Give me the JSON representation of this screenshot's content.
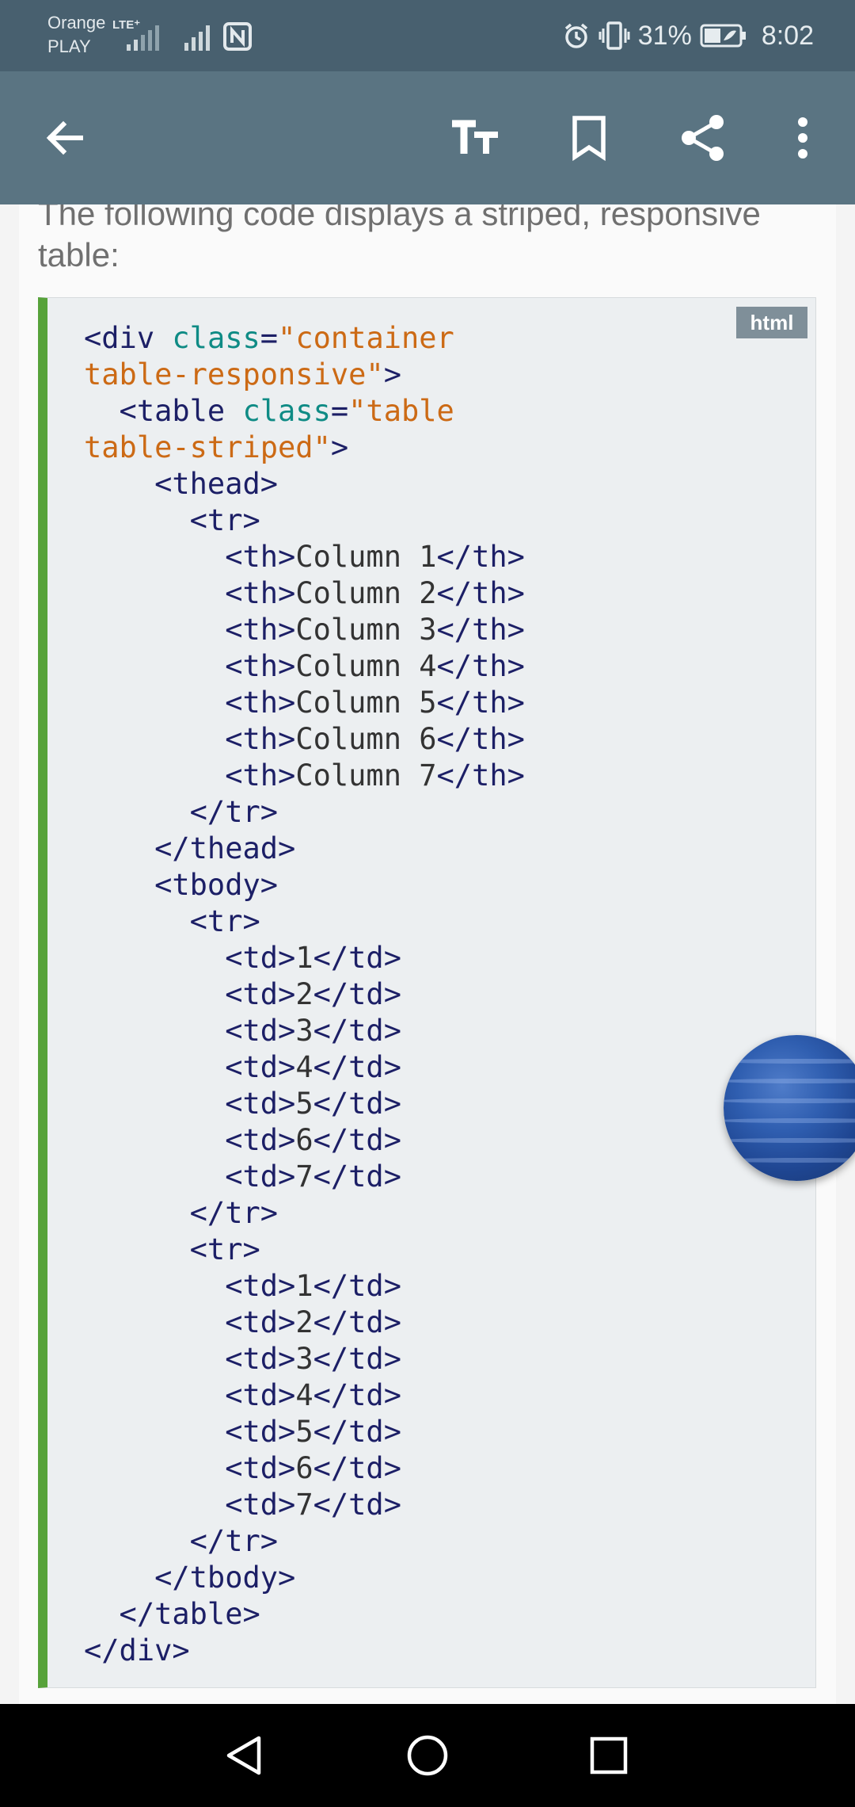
{
  "status_bar": {
    "carrier_line1": "Orange",
    "carrier_line2": "PLAY",
    "network": "LTE⁺",
    "battery_percent": "31%",
    "time": "8:02"
  },
  "app_bar": {
    "back_icon": "arrow-left-icon",
    "text_size_icon": "text-size-icon",
    "bookmark_icon": "bookmark-icon",
    "share_icon": "share-icon",
    "more_icon": "more-vert-icon"
  },
  "article": {
    "intro_text": "The following code displays a striped, responsive table:"
  },
  "code_block": {
    "language": "html",
    "lines": [
      [
        {
          "t": "tag",
          "v": "<div "
        },
        {
          "t": "attr",
          "v": "class"
        },
        {
          "t": "eq",
          "v": "="
        },
        {
          "t": "str",
          "v": "\"container"
        }
      ],
      [
        {
          "t": "str",
          "v": "table-responsive\""
        },
        {
          "t": "tag",
          "v": ">"
        }
      ],
      [
        {
          "t": "tag",
          "v": "  <table "
        },
        {
          "t": "attr",
          "v": "class"
        },
        {
          "t": "eq",
          "v": "="
        },
        {
          "t": "str",
          "v": "\"table"
        }
      ],
      [
        {
          "t": "str",
          "v": "table-striped\""
        },
        {
          "t": "tag",
          "v": ">"
        }
      ],
      [
        {
          "t": "tag",
          "v": "    <thead>"
        }
      ],
      [
        {
          "t": "tag",
          "v": "      <tr>"
        }
      ],
      [
        {
          "t": "tag",
          "v": "        <th>"
        },
        {
          "t": "text",
          "v": "Column 1"
        },
        {
          "t": "tag",
          "v": "</th>"
        }
      ],
      [
        {
          "t": "tag",
          "v": "        <th>"
        },
        {
          "t": "text",
          "v": "Column 2"
        },
        {
          "t": "tag",
          "v": "</th>"
        }
      ],
      [
        {
          "t": "tag",
          "v": "        <th>"
        },
        {
          "t": "text",
          "v": "Column 3"
        },
        {
          "t": "tag",
          "v": "</th>"
        }
      ],
      [
        {
          "t": "tag",
          "v": "        <th>"
        },
        {
          "t": "text",
          "v": "Column 4"
        },
        {
          "t": "tag",
          "v": "</th>"
        }
      ],
      [
        {
          "t": "tag",
          "v": "        <th>"
        },
        {
          "t": "text",
          "v": "Column 5"
        },
        {
          "t": "tag",
          "v": "</th>"
        }
      ],
      [
        {
          "t": "tag",
          "v": "        <th>"
        },
        {
          "t": "text",
          "v": "Column 6"
        },
        {
          "t": "tag",
          "v": "</th>"
        }
      ],
      [
        {
          "t": "tag",
          "v": "        <th>"
        },
        {
          "t": "text",
          "v": "Column 7"
        },
        {
          "t": "tag",
          "v": "</th>"
        }
      ],
      [
        {
          "t": "tag",
          "v": "      </tr>"
        }
      ],
      [
        {
          "t": "tag",
          "v": "    </thead>"
        }
      ],
      [
        {
          "t": "tag",
          "v": "    <tbody>"
        }
      ],
      [
        {
          "t": "tag",
          "v": "      <tr>"
        }
      ],
      [
        {
          "t": "tag",
          "v": "        <td>"
        },
        {
          "t": "text",
          "v": "1"
        },
        {
          "t": "tag",
          "v": "</td>"
        }
      ],
      [
        {
          "t": "tag",
          "v": "        <td>"
        },
        {
          "t": "text",
          "v": "2"
        },
        {
          "t": "tag",
          "v": "</td>"
        }
      ],
      [
        {
          "t": "tag",
          "v": "        <td>"
        },
        {
          "t": "text",
          "v": "3"
        },
        {
          "t": "tag",
          "v": "</td>"
        }
      ],
      [
        {
          "t": "tag",
          "v": "        <td>"
        },
        {
          "t": "text",
          "v": "4"
        },
        {
          "t": "tag",
          "v": "</td>"
        }
      ],
      [
        {
          "t": "tag",
          "v": "        <td>"
        },
        {
          "t": "text",
          "v": "5"
        },
        {
          "t": "tag",
          "v": "</td>"
        }
      ],
      [
        {
          "t": "tag",
          "v": "        <td>"
        },
        {
          "t": "text",
          "v": "6"
        },
        {
          "t": "tag",
          "v": "</td>"
        }
      ],
      [
        {
          "t": "tag",
          "v": "        <td>"
        },
        {
          "t": "text",
          "v": "7"
        },
        {
          "t": "tag",
          "v": "</td>"
        }
      ],
      [
        {
          "t": "tag",
          "v": "      </tr>"
        }
      ],
      [
        {
          "t": "tag",
          "v": "      <tr>"
        }
      ],
      [
        {
          "t": "tag",
          "v": "        <td>"
        },
        {
          "t": "text",
          "v": "1"
        },
        {
          "t": "tag",
          "v": "</td>"
        }
      ],
      [
        {
          "t": "tag",
          "v": "        <td>"
        },
        {
          "t": "text",
          "v": "2"
        },
        {
          "t": "tag",
          "v": "</td>"
        }
      ],
      [
        {
          "t": "tag",
          "v": "        <td>"
        },
        {
          "t": "text",
          "v": "3"
        },
        {
          "t": "tag",
          "v": "</td>"
        }
      ],
      [
        {
          "t": "tag",
          "v": "        <td>"
        },
        {
          "t": "text",
          "v": "4"
        },
        {
          "t": "tag",
          "v": "</td>"
        }
      ],
      [
        {
          "t": "tag",
          "v": "        <td>"
        },
        {
          "t": "text",
          "v": "5"
        },
        {
          "t": "tag",
          "v": "</td>"
        }
      ],
      [
        {
          "t": "tag",
          "v": "        <td>"
        },
        {
          "t": "text",
          "v": "6"
        },
        {
          "t": "tag",
          "v": "</td>"
        }
      ],
      [
        {
          "t": "tag",
          "v": "        <td>"
        },
        {
          "t": "text",
          "v": "7"
        },
        {
          "t": "tag",
          "v": "</td>"
        }
      ],
      [
        {
          "t": "tag",
          "v": "      </tr>"
        }
      ],
      [
        {
          "t": "tag",
          "v": "    </tbody>"
        }
      ],
      [
        {
          "t": "tag",
          "v": "  </table>"
        }
      ],
      [
        {
          "t": "tag",
          "v": "</div>"
        }
      ]
    ]
  },
  "floating_bubble": {
    "icon": "chat-head-bubble-icon"
  },
  "nav_bar": {
    "back_icon": "nav-back-icon",
    "home_icon": "nav-home-icon",
    "recents_icon": "nav-recents-icon"
  },
  "colors": {
    "status_bar": "#48606f",
    "app_bar": "#5a7482",
    "code_accent": "#57a23a",
    "code_background": "#eceff1",
    "string": "#cc6a15",
    "attribute": "#0f8b85",
    "tag": "#1c1f66"
  }
}
